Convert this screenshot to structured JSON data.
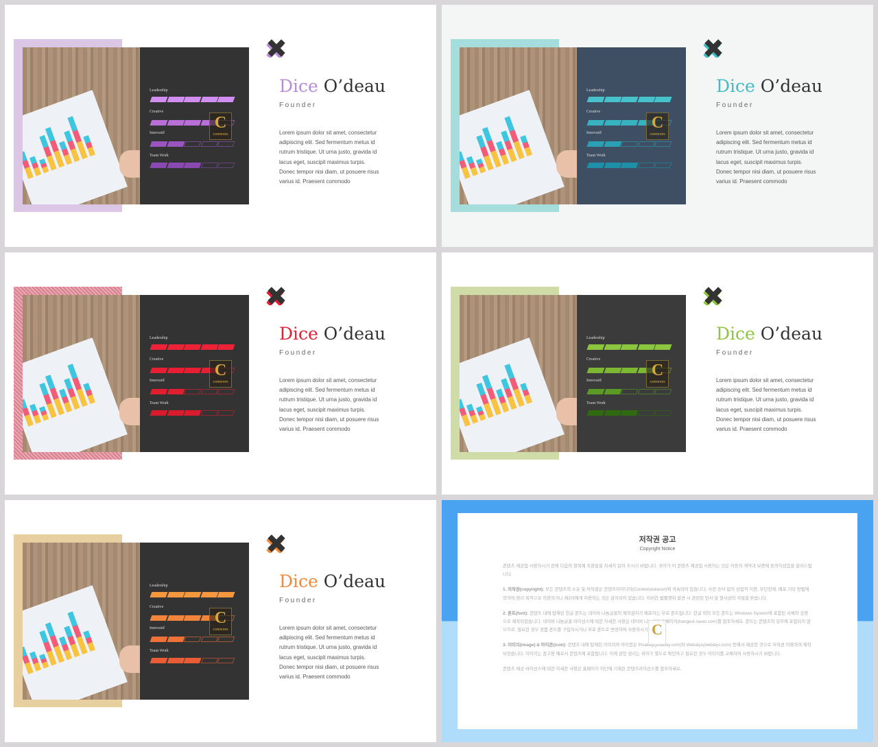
{
  "profile": {
    "first_name": "Dice",
    "last_name": "O’deau",
    "role": "Founder",
    "description": "Lorem ipsum dolor sit amet, consectetur adipiscing  elit. Sed fermentum metus id rutrum tristique. Ut urna justo, gravida id lacus eget, suscipit maximus turpis. Donec tempor nisi diam, ut posuere risus varius id. Praesent commodo",
    "skills": [
      {
        "label": "Leadership",
        "level": 5
      },
      {
        "label": "Creative",
        "level": 4
      },
      {
        "label": "Innovatif",
        "level": 2
      },
      {
        "label": "Team Work",
        "level": 3
      }
    ],
    "skill_max": 5
  },
  "logo_text": "C",
  "logo_subtext": "CONTENTS",
  "slides": [
    {
      "theme": "purple",
      "accent": "#b98bd8",
      "frame": "#dcc6e6",
      "panel": "#333333",
      "bg": "#ffffff",
      "shades": [
        "#d08ff0",
        "#b86fd8",
        "#9a55c0",
        "#8a49b0"
      ]
    },
    {
      "theme": "teal",
      "accent": "#3fbcc8",
      "frame": "#a5dcdc",
      "panel": "#3f4f63",
      "bg": "#f4f5f5",
      "shades": [
        "#45c2cc",
        "#36b2c0",
        "#2aa0b4",
        "#1d90a8"
      ]
    },
    {
      "theme": "red",
      "accent": "#e21f36",
      "frame": "#d9808f",
      "panel": "#333333",
      "bg": "#ffffff",
      "shades": [
        "#ee2236",
        "#e81f33",
        "#e01e30",
        "#d81c2e"
      ],
      "striped": true
    },
    {
      "theme": "green",
      "accent": "#8cc63f",
      "frame": "#cfdca8",
      "panel": "#3b3b3b",
      "bg": "#ffffff",
      "shades": [
        "#8cc63f",
        "#7cb832",
        "#5b9a24",
        "#2f6a10"
      ]
    },
    {
      "theme": "orange",
      "accent": "#f08a3c",
      "frame": "#e8cfa0",
      "panel": "#333333",
      "bg": "#ffffff",
      "shades": [
        "#f5973d",
        "#f2853a",
        "#ee7238",
        "#e85d36"
      ]
    }
  ],
  "copyright": {
    "title": "저작권 공고",
    "subtitle": "Copyright Notice",
    "intro": "콘텐츠 제공업 사용하시기 전에 다음의 항목에 조항들을 자세히 읽어 주시기 바랍니다. 귀하가 이 콘텐츠 제공업 사용하는 것은 이용자 계약과 보증에 동의하셨음을 알려드립니다.",
    "items": [
      {
        "heading": "1. 저작권(copyright):",
        "text": "모든 콘텐츠의 소유 및 저작권은 콘텐츠아이디어(Contentstokeout)에 귀속되어 있습니다. 사전 승낙 없이 상업적 이용, 무단전재, 배포 기타 방법에 의하여 영리 목적으로 이용하거나 제3자에게 이용하는 것은 금지되어 있습니다. 이러한 법률행위 발견 시 관련된 민사 및 형사상의 처벌을 받습니다."
      },
      {
        "heading": "2. 폰트(font):",
        "text": "콘텐츠 내에 탑재된 한글 폰트는 네이버 나눔글꼴의 제작권자가 배포하는 무료 폰트입니다. 한글 외의 모든 폰트는 Windows System에 포함된 서체와 공용으로 제작되었습니다. 네이버 나눔글꼴 라이선스에 대한 자세한 사항은 네이버 나눔글꼴 홈페이지(hangeul.naver.com)를 참조하세요. 폰트는 콘텐츠의 일부에 포함되지 않으므로, 필요한 경우 정품 폰트를 구입하시거나 무료 폰트로 변경하여 사용하시기 바랍니다."
      },
      {
        "heading": "3. 이미지(image) & 아이콘(icon):",
        "text": "콘텐츠 내에 탑재된 이미지와 아이콘은 Pixabay(pixabay.com)와 Webalys(webalys.com) 등에서 제공한 것으로 저작권 이용하여 제작되었습니다. 이미지는 참고용 예로서 콘텐츠에 포함됩니다. 이에 관한 권리는 귀하가 별도로 확인하고 필요한 경우 이미지를 교체하여 사용하시기 바랍니다."
      }
    ],
    "footer": "콘텐츠 제공 라이선스에 대한 자세한 사항은 홈페이지 하단에 기재된 콘텐츠라이선스를 참조하세요."
  }
}
